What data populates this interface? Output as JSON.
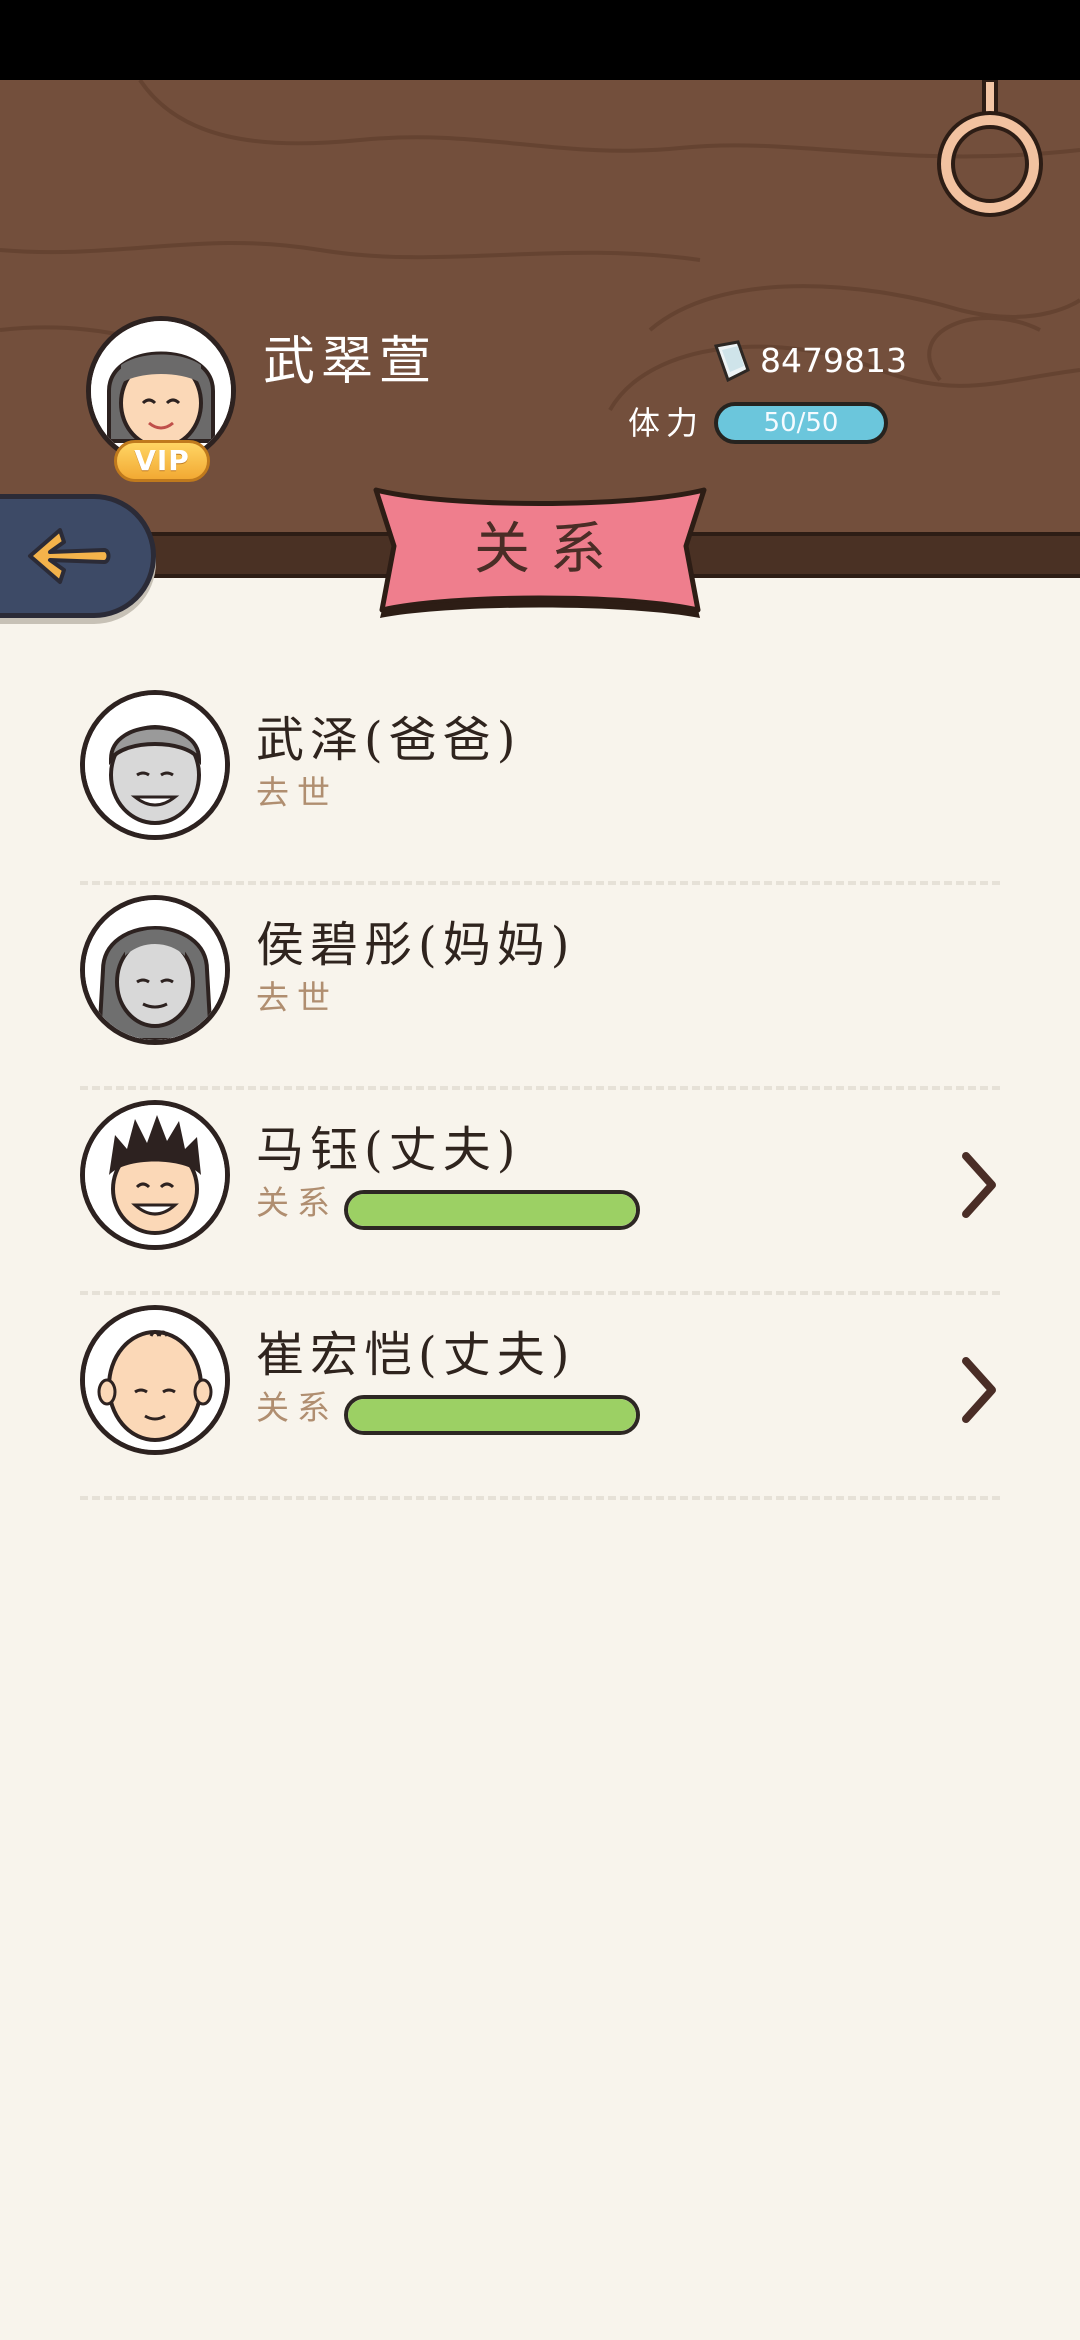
{
  "header": {
    "player_name": "武翠萱",
    "vip_label": "VIP",
    "money": "8479813",
    "stamina_label": "体力",
    "stamina_value": "50/50"
  },
  "page": {
    "title": "关系"
  },
  "relations": [
    {
      "name": "武泽(爸爸)",
      "status": "去世",
      "avatar": "father-icon"
    },
    {
      "name": "侯碧彤(妈妈)",
      "status": "去世",
      "avatar": "mother-icon"
    },
    {
      "name": "马钰(丈夫)",
      "relation_label": "关系",
      "relation_level": 1.0,
      "avatar": "husband-icon"
    },
    {
      "name": "崔宏恺(丈夫)",
      "relation_label": "关系",
      "relation_level": 1.0,
      "avatar": "husband-bald-icon"
    }
  ],
  "colors": {
    "header_bg": "#734f3c",
    "banner": "#ef7e8d",
    "stamina": "#6bc6dc",
    "relation_fill": "#9cd064",
    "back_button": "#3d4a66"
  }
}
